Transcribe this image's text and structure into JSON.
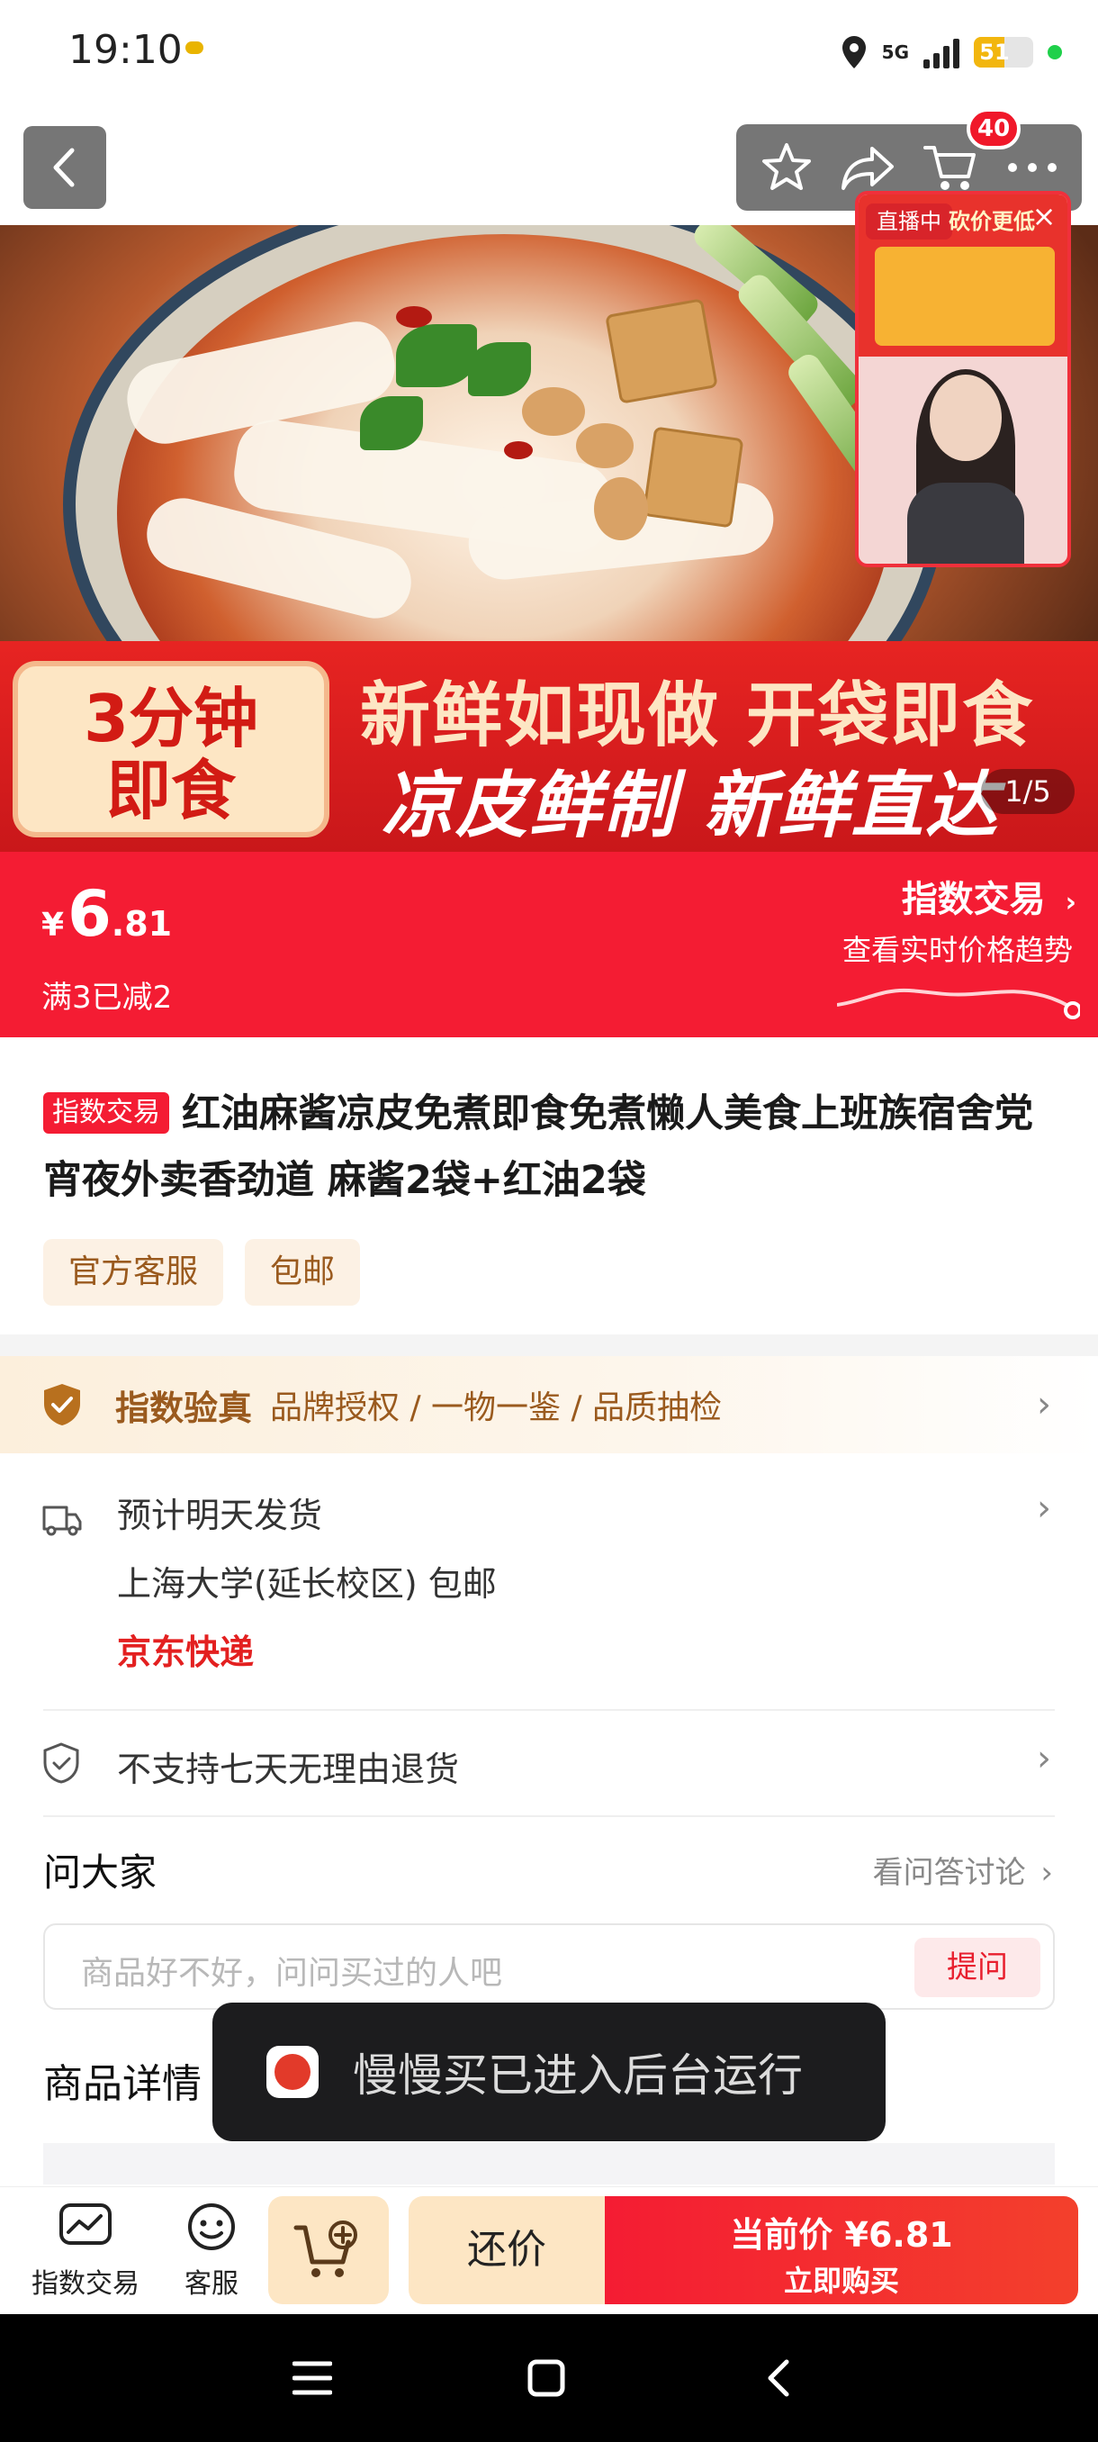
{
  "status_bar": {
    "time": "19:10",
    "network": "5G",
    "battery": "51",
    "battery_level": 0.51
  },
  "nav": {
    "cart_count": "40"
  },
  "hero": {
    "badge": "3分钟\n即食",
    "line1": "新鲜如现做 开袋即食",
    "line2": "凉皮鲜制 新鲜直达",
    "page_indicator": "1/5",
    "live_label": "直播中",
    "live_banner": "砍价更低"
  },
  "price": {
    "currency": "¥",
    "integer": "6",
    "decimal": ".81",
    "promo": "满3已减2",
    "index_trade": "指数交易",
    "index_sub": "查看实时价格趋势"
  },
  "product": {
    "tag": "指数交易",
    "title": "红油麻酱凉皮免煮即食免煮懒人美食上班族宿舍党宵夜外卖香劲道 麻酱2袋+红油2袋",
    "tags": [
      "官方客服",
      "包邮"
    ]
  },
  "verify": {
    "title": "指数验真",
    "sub": "品牌授权 / 一物一鉴 / 品质抽检"
  },
  "shipping": {
    "line1": "预计明天发货",
    "line2": "上海大学(延长校区) 包邮",
    "carrier": "京东快递"
  },
  "returns": {
    "text": "不支持七天无理由退货"
  },
  "ask": {
    "header": "问大家",
    "link": "看问答讨论",
    "placeholder": "商品好不好，问问买过的人吧",
    "button": "提问"
  },
  "detail": {
    "header": "商品详情"
  },
  "toast": {
    "text": "慢慢买已进入后台运行"
  },
  "bottom": {
    "index_label": "指数交易",
    "service_label": "客服",
    "bargain": "还价",
    "buy_price": "当前价 ¥6.81",
    "buy_label": "立即购买"
  },
  "colors": {
    "accent_red": "#f41c33",
    "gold": "#9a5a1e",
    "cream": "#fde6c4"
  }
}
